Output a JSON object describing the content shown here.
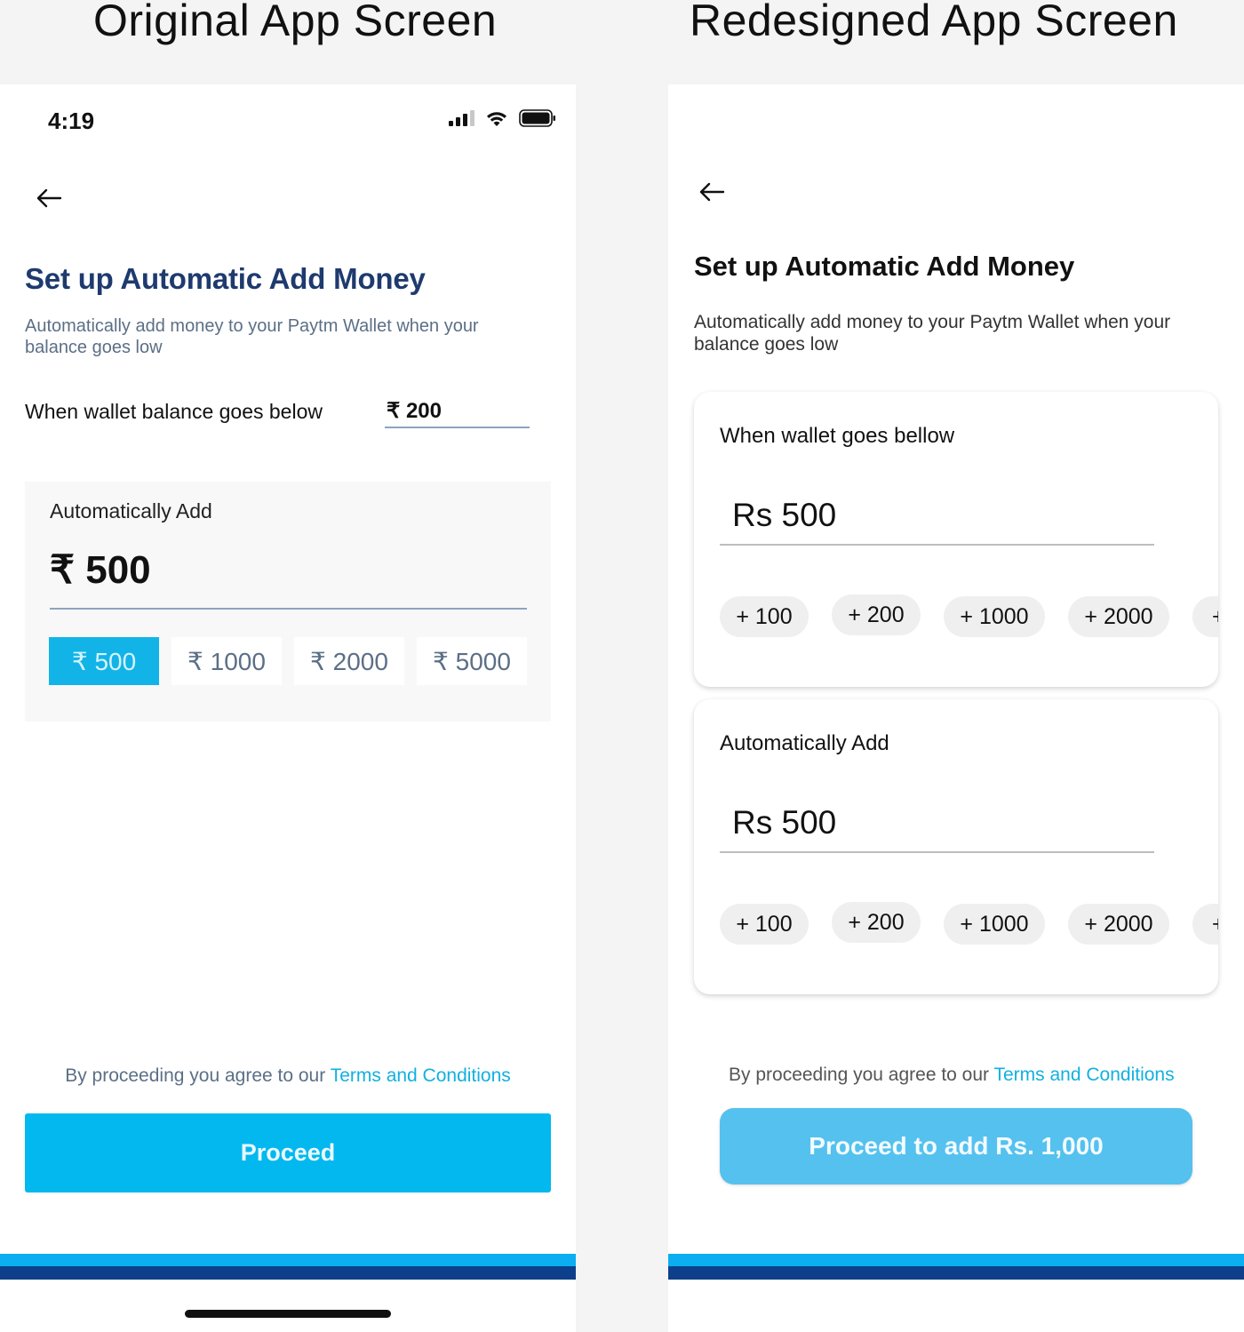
{
  "headings": {
    "left": "Original App Screen",
    "right": "Redesigned App Screen"
  },
  "original": {
    "status_time": "4:19",
    "title": "Set up Automatic Add Money",
    "description": "Automatically add money to your Paytm Wallet when your balance goes low",
    "below_label": "When wallet balance goes below",
    "below_value": "₹ 200",
    "add_label": "Automatically Add",
    "add_amount": "₹ 500",
    "chips": [
      {
        "label": "₹ 500",
        "selected": true
      },
      {
        "label": "₹ 1000",
        "selected": false
      },
      {
        "label": "₹ 2000",
        "selected": false
      },
      {
        "label": "₹ 5000",
        "selected": false
      }
    ],
    "terms_prefix": "By proceeding you agree to our",
    "terms_link": "Terms and Conditions",
    "proceed_label": "Proceed"
  },
  "redesign": {
    "title": "Set up Automatic Add Money",
    "description": "Automatically add money to your Paytm Wallet when your balance goes low",
    "below_card": {
      "label": "When wallet goes bellow",
      "value": "Rs 500",
      "chips": [
        "+ 100",
        "+ 200",
        "+ 1000",
        "+ 2000",
        "+"
      ]
    },
    "add_card": {
      "label": "Automatically Add",
      "value": "Rs 500",
      "chips": [
        "+ 100",
        "+ 200",
        "+ 1000",
        "+ 2000",
        "+"
      ]
    },
    "terms_prefix": "By proceeding you agree to our",
    "terms_link": "Terms and Conditions",
    "proceed_label": "Proceed to add Rs. 1,000"
  },
  "colors": {
    "title_navy": "#1e3a6e",
    "accent_blue": "#02b8ef",
    "selected_chip": "#12b4e8",
    "redesign_button": "#55c1ef",
    "band_light": "#0baef0",
    "band_dark": "#0d3f8a",
    "link": "#12b0e0"
  },
  "icons": {
    "back": "back-arrow-icon",
    "signal": "cellular-signal-icon",
    "wifi": "wifi-icon",
    "battery": "battery-icon"
  }
}
